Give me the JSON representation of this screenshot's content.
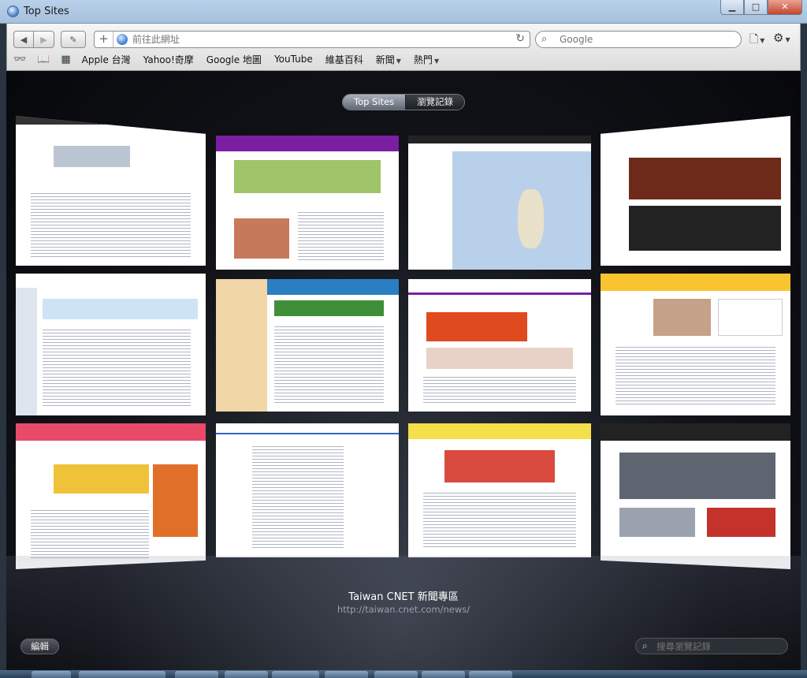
{
  "window": {
    "title": "Top Sites"
  },
  "toolbar": {
    "address_placeholder": "前往此網址",
    "search_placeholder": "Google"
  },
  "bookmarks": [
    {
      "label": "Apple 台灣",
      "menu": false
    },
    {
      "label": "Yahoo!奇摩",
      "menu": false
    },
    {
      "label": "Google 地圖",
      "menu": false
    },
    {
      "label": "YouTube",
      "menu": false
    },
    {
      "label": "維基百科",
      "menu": false
    },
    {
      "label": "新聞",
      "menu": true
    },
    {
      "label": "熱門",
      "menu": true
    }
  ],
  "topsites": {
    "tabs": [
      "Top Sites",
      "瀏覽記錄"
    ],
    "active_tab": "Top Sites",
    "selected_title": "Taiwan CNET 新聞專區",
    "selected_url": "http://taiwan.cnet.com/news/",
    "edit_label": "編輯",
    "history_search_placeholder": "搜尋瀏覽記錄"
  },
  "colors": {
    "accent": "#4d8ee0",
    "yahoo_purple": "#7b1fa2",
    "google_blue": "#3366cc"
  }
}
